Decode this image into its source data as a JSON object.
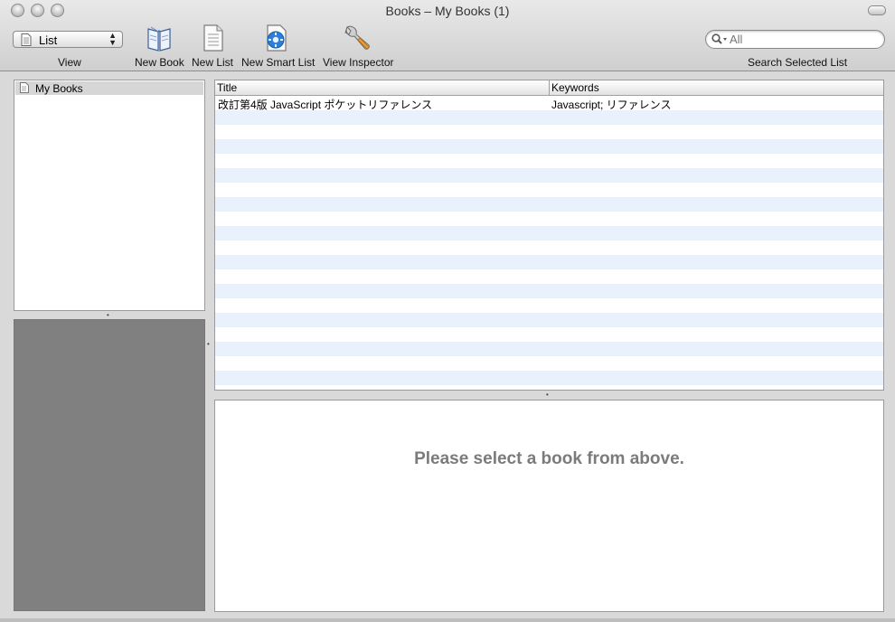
{
  "window": {
    "title": "Books – My Books (1)"
  },
  "toolbar": {
    "view_selected": "List",
    "view_label": "View",
    "new_book_label": "New Book",
    "new_list_label": "New List",
    "new_smart_list_label": "New Smart List",
    "view_inspector_label": "View Inspector",
    "search_placeholder": "All",
    "search_label": "Search Selected List"
  },
  "sidebar": {
    "items": [
      {
        "label": "My Books",
        "selected": true
      }
    ]
  },
  "table": {
    "columns": [
      "Title",
      "Keywords"
    ],
    "rows": [
      {
        "title": "改訂第4版 JavaScript ポケットリファレンス",
        "keywords": "Javascript; リファレンス"
      }
    ],
    "stripe_color": "#e9f1fc"
  },
  "detail": {
    "message": "Please select a book from above."
  }
}
